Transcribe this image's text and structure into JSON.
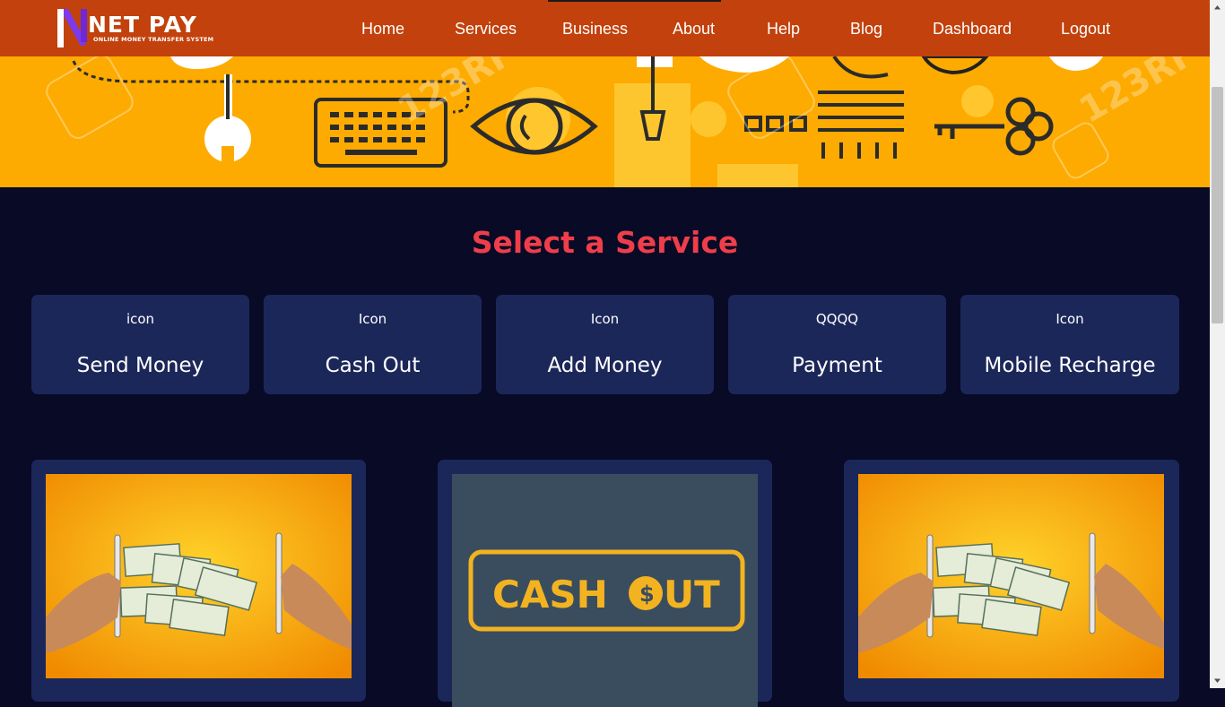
{
  "brand": {
    "logo_letter": "N",
    "title": "NET PAY",
    "tagline": "ONLINE MONEY TRANSFER SYSTEM"
  },
  "nav": {
    "items": [
      {
        "label": "Home"
      },
      {
        "label": "Services"
      },
      {
        "label": "Business"
      },
      {
        "label": "About"
      },
      {
        "label": "Help"
      },
      {
        "label": "Blog"
      },
      {
        "label": "Dashboard"
      },
      {
        "label": "Logout"
      }
    ]
  },
  "hero": {
    "watermark": "123RF"
  },
  "services": {
    "title": "Select a Service",
    "cards": [
      {
        "icon": "icon",
        "label": "Send Money"
      },
      {
        "icon": "Icon",
        "label": "Cash Out"
      },
      {
        "icon": "Icon",
        "label": "Add Money"
      },
      {
        "icon": "QQQQ",
        "label": "Payment"
      },
      {
        "icon": "Icon",
        "label": "Mobile Recharge"
      }
    ]
  },
  "features": {
    "cashout_text": "CASH",
    "cashout_text2": "UT",
    "cashout_coin": "$"
  },
  "colors": {
    "navbar": "#c2410c",
    "hero": "#fdab01",
    "page_bg": "#080a26",
    "card_bg": "#1c2759",
    "title_red": "#ef3e4a",
    "cashout_bg": "#3a4d5e",
    "cashout_gold": "#f3b320"
  }
}
